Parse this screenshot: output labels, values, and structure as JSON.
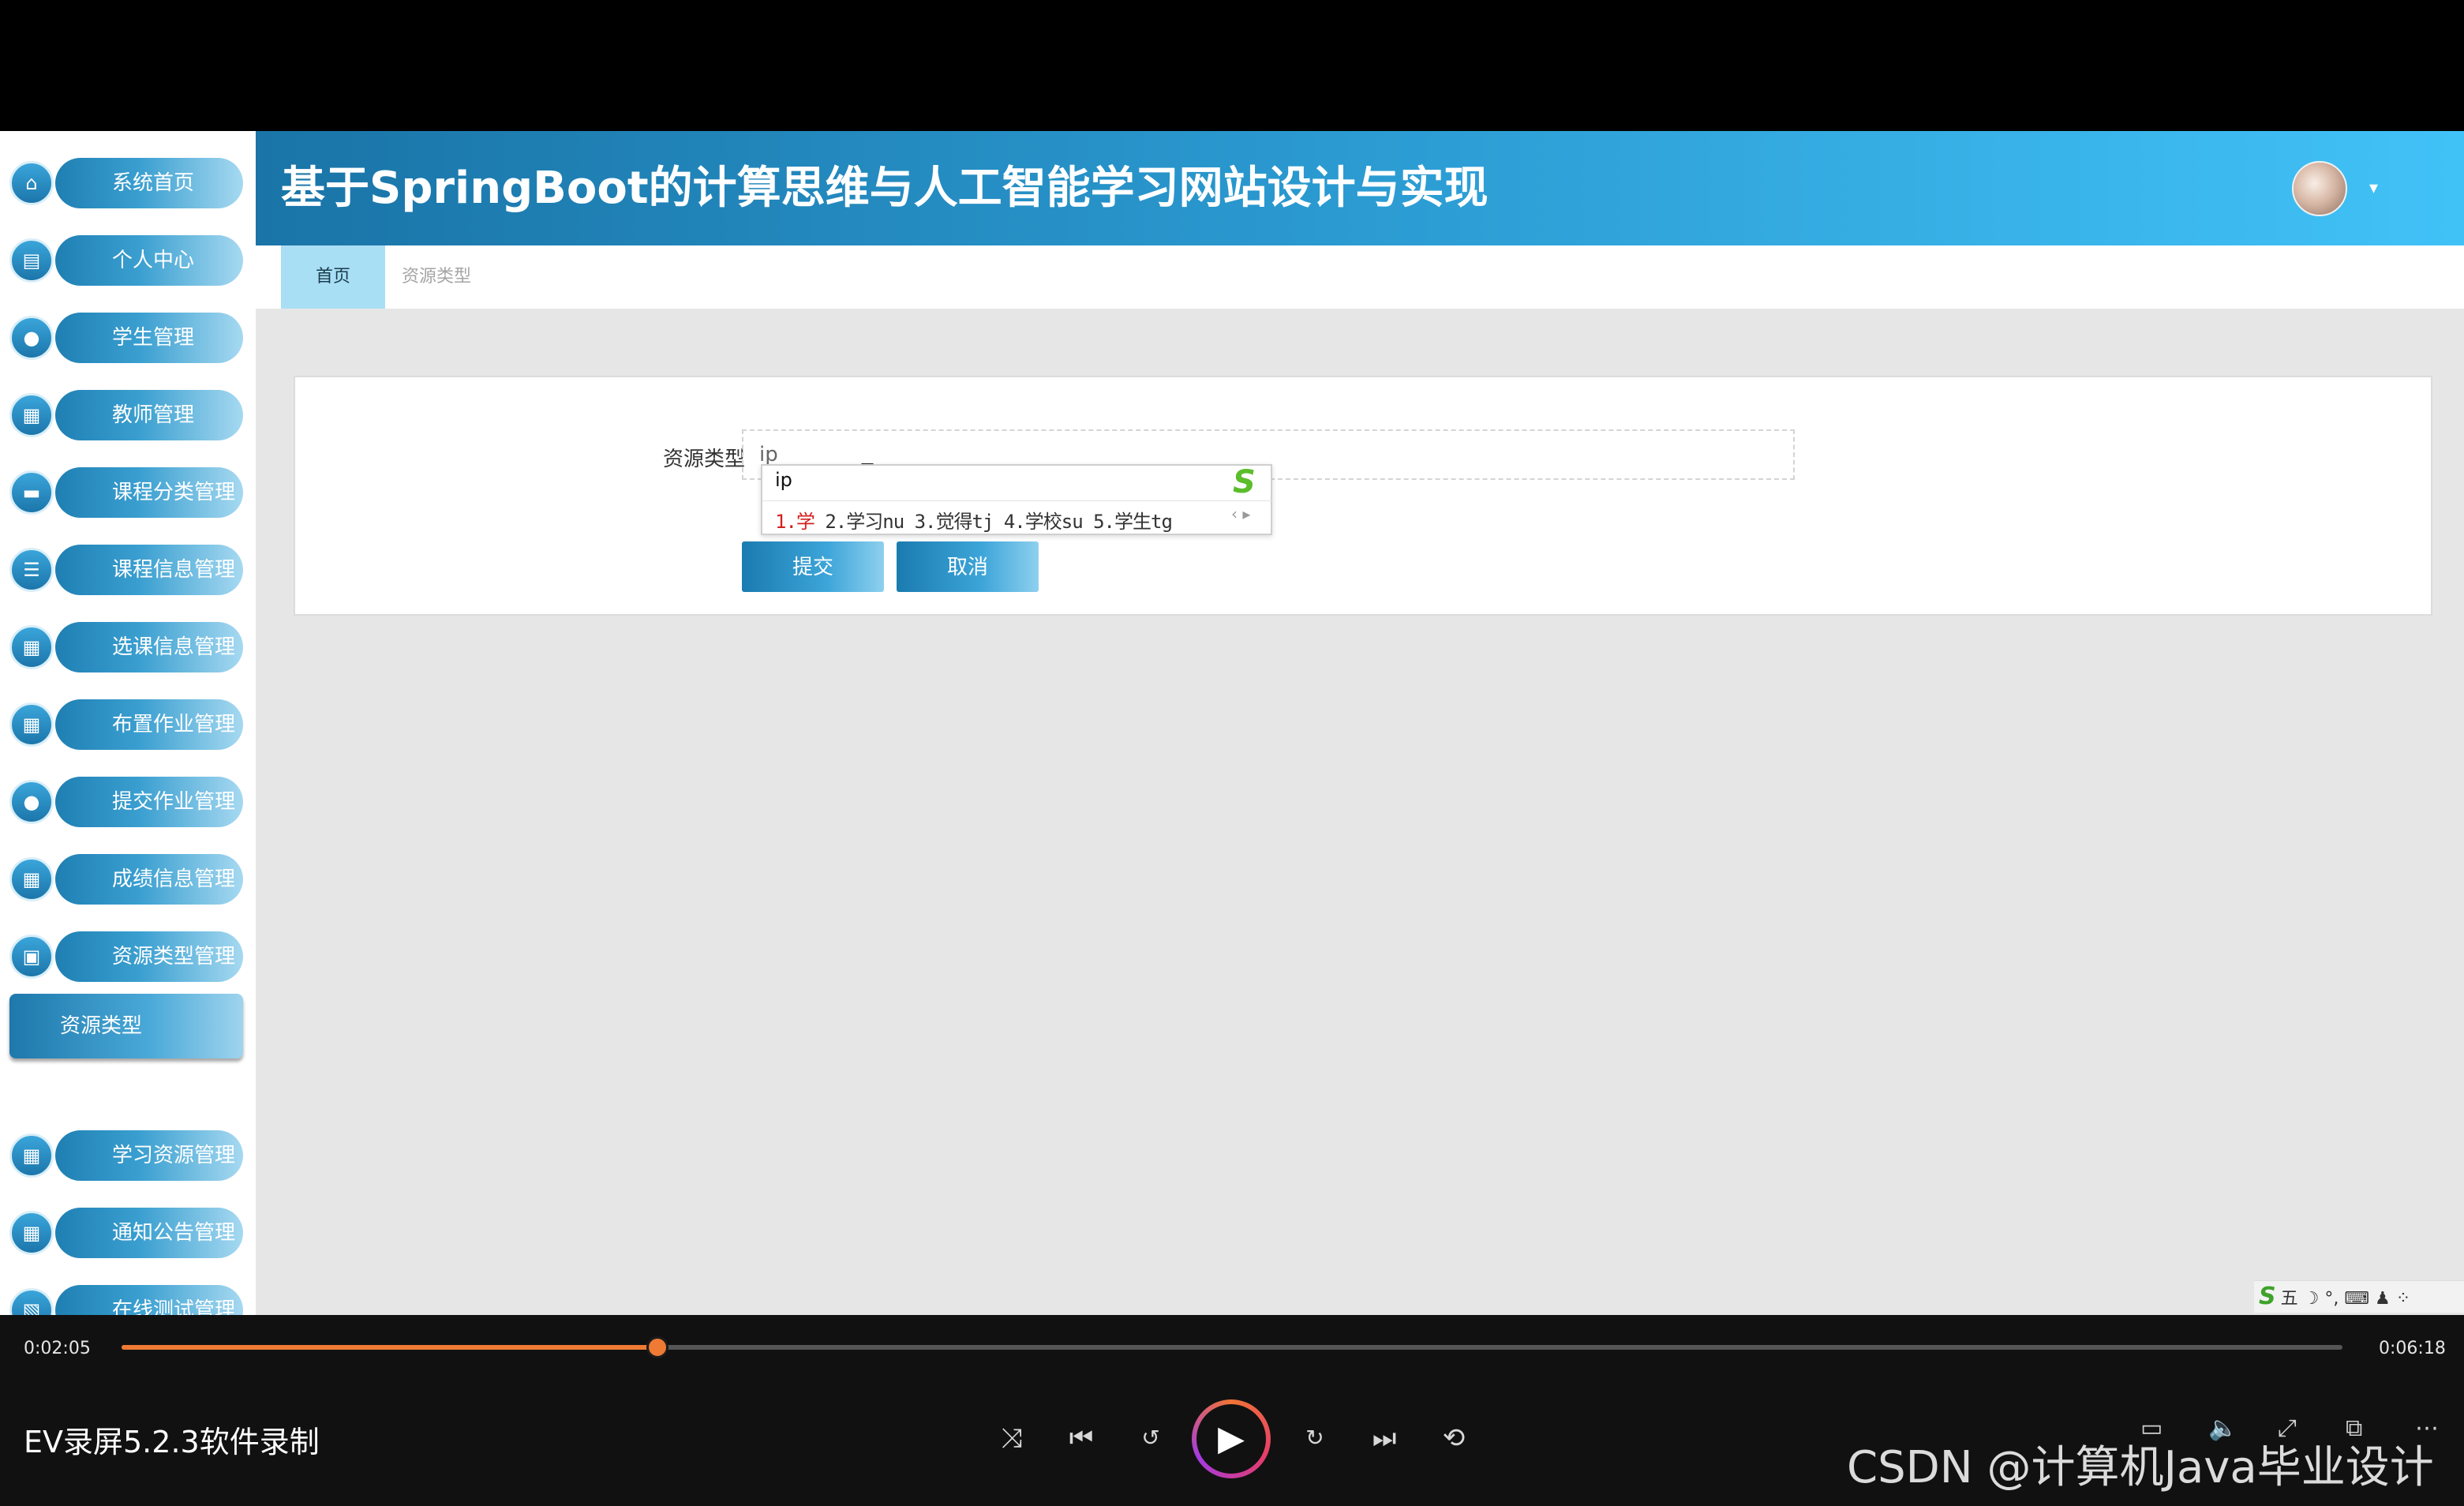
{
  "app": {
    "title": "基于SpringBoot的计算思维与人工智能学习网站设计与实现"
  },
  "sidebar": {
    "items": [
      {
        "label": "系统首页",
        "icon": "home-icon",
        "glyph": "⌂"
      },
      {
        "label": "个人中心",
        "icon": "id-card-icon",
        "glyph": "▤"
      },
      {
        "label": "学生管理",
        "icon": "user-icon",
        "glyph": "●"
      },
      {
        "label": "教师管理",
        "icon": "grid-icon",
        "glyph": "▦"
      },
      {
        "label": "课程分类管理",
        "icon": "ticket-icon",
        "glyph": "▬"
      },
      {
        "label": "课程信息管理",
        "icon": "list-icon",
        "glyph": "☰"
      },
      {
        "label": "选课信息管理",
        "icon": "grid-icon",
        "glyph": "▦"
      },
      {
        "label": "布置作业管理",
        "icon": "grid-icon",
        "glyph": "▦"
      },
      {
        "label": "提交作业管理",
        "icon": "user-icon",
        "glyph": "●"
      },
      {
        "label": "成绩信息管理",
        "icon": "grid-icon",
        "glyph": "▦"
      },
      {
        "label": "资源类型管理",
        "icon": "briefcase-icon",
        "glyph": "▣"
      },
      {
        "label": "学习资源管理",
        "icon": "grid-icon",
        "glyph": "▦"
      },
      {
        "label": "通知公告管理",
        "icon": "table-icon",
        "glyph": "▦"
      },
      {
        "label": "在线测试管理",
        "icon": "chart-icon",
        "glyph": "▧"
      }
    ],
    "active_sub": "资源类型"
  },
  "tabs": [
    {
      "label": "首页",
      "active": true
    },
    {
      "label": "资源类型",
      "active": false
    }
  ],
  "form": {
    "field_label": "资源类型",
    "field_value": "ip",
    "submit_label": "提交",
    "cancel_label": "取消"
  },
  "ime": {
    "composition": "ip",
    "first_candidate": "1.学",
    "other_candidates": " 2.学习nu 3.觉得tj 4.学校su 5.学生tg",
    "logo": "S"
  },
  "tray": {
    "logo": "S",
    "label": "五 ☽ °, ⌨ ♟ ⁘"
  },
  "player": {
    "current_time": "0:02:05",
    "total_time": "0:06:18",
    "progress": 0.2414,
    "brand": "EV录屏5.2.3软件录制",
    "watermark": "CSDN @计算机Java毕业设计"
  },
  "colors": {
    "accent": "#2b9bd2",
    "progress": "#ef7a34"
  }
}
